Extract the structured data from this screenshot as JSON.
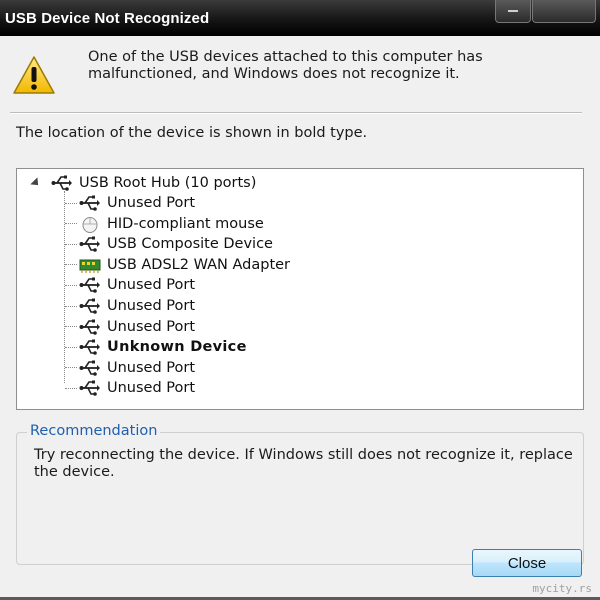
{
  "window": {
    "title": "USB Device Not Recognized"
  },
  "message": {
    "line1": "One of the USB devices attached to this computer has",
    "line2": "malfunctioned, and Windows does not recognize it."
  },
  "location_text": "The location of the device is shown in bold type.",
  "tree": {
    "root": {
      "label": "USB Root Hub (10 ports)",
      "icon": "usb-icon",
      "expanded": true
    },
    "items": [
      {
        "label": "Unused Port",
        "icon": "usb-icon",
        "bold": false
      },
      {
        "label": "HID-compliant mouse",
        "icon": "mouse-icon",
        "bold": false
      },
      {
        "label": "USB Composite Device",
        "icon": "usb-icon",
        "bold": false
      },
      {
        "label": "USB ADSL2 WAN Adapter",
        "icon": "network-adapter-icon",
        "bold": false
      },
      {
        "label": "Unused Port",
        "icon": "usb-icon",
        "bold": false
      },
      {
        "label": "Unused Port",
        "icon": "usb-icon",
        "bold": false
      },
      {
        "label": "Unused Port",
        "icon": "usb-icon",
        "bold": false
      },
      {
        "label": "Unknown Device",
        "icon": "usb-icon",
        "bold": true
      },
      {
        "label": "Unused Port",
        "icon": "usb-icon",
        "bold": false
      },
      {
        "label": "Unused Port",
        "icon": "usb-icon",
        "bold": false
      }
    ]
  },
  "recommendation": {
    "label": "Recommendation",
    "text": "Try reconnecting the device. If Windows still does not recognize it, replace the device."
  },
  "buttons": {
    "close_label": "Close"
  },
  "watermark": "mycity.rs",
  "colors": {
    "titlebar": "#000000",
    "group_label": "#1f5fae",
    "button_border": "#3c7fb1"
  }
}
